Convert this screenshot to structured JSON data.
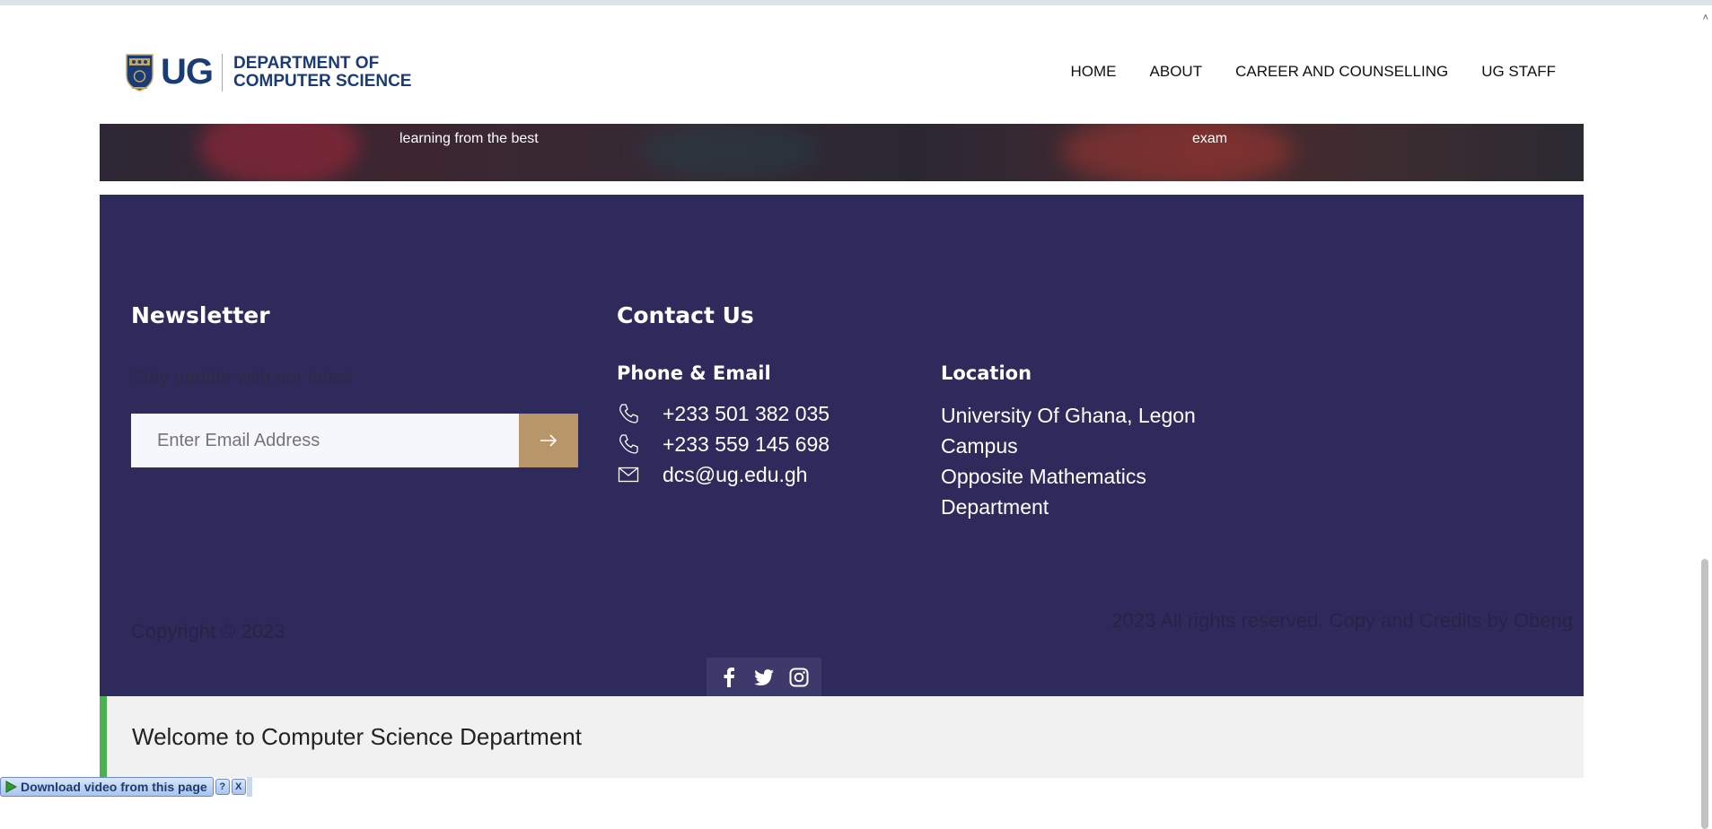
{
  "header": {
    "logo_ug": "UG",
    "logo_line1": "DEPARTMENT OF",
    "logo_line2": "COMPUTER SCIENCE",
    "nav": [
      "HOME",
      "ABOUT",
      "CAREER AND COUNSELLING",
      "UG STAFF"
    ]
  },
  "hero": {
    "caption_left": "learning from the best",
    "caption_right": "exam"
  },
  "footer": {
    "newsletter_title": "Newsletter",
    "newsletter_tagline": "Stay update with our latest",
    "email_placeholder": "Enter Email Address",
    "contact_title": "Contact Us",
    "phone_email_title": "Phone & Email",
    "phone1": "+233 501 382 035",
    "phone2": "+233 559 145 698",
    "email": "dcs@ug.edu.gh",
    "location_title": "Location",
    "location_lines": [
      "University Of Ghana, Legon",
      "Campus",
      "Opposite Mathematics",
      "Department"
    ],
    "copyright": "Copyright © 2023",
    "rights": "2023 All rights reserved. Copy and Credits by Obeng",
    "social": [
      "facebook-icon",
      "twitter-icon",
      "instagram-icon"
    ]
  },
  "welcome": {
    "text": "Welcome to Computer Science Department"
  },
  "download_bar": {
    "label": "Download video from this page",
    "help": "?",
    "close": "X"
  },
  "colors": {
    "brand_blue": "#1b3b74",
    "footer_bg": "#2e2b5c",
    "submit_gold": "#b9966a",
    "welcome_accent": "#4caf50"
  }
}
